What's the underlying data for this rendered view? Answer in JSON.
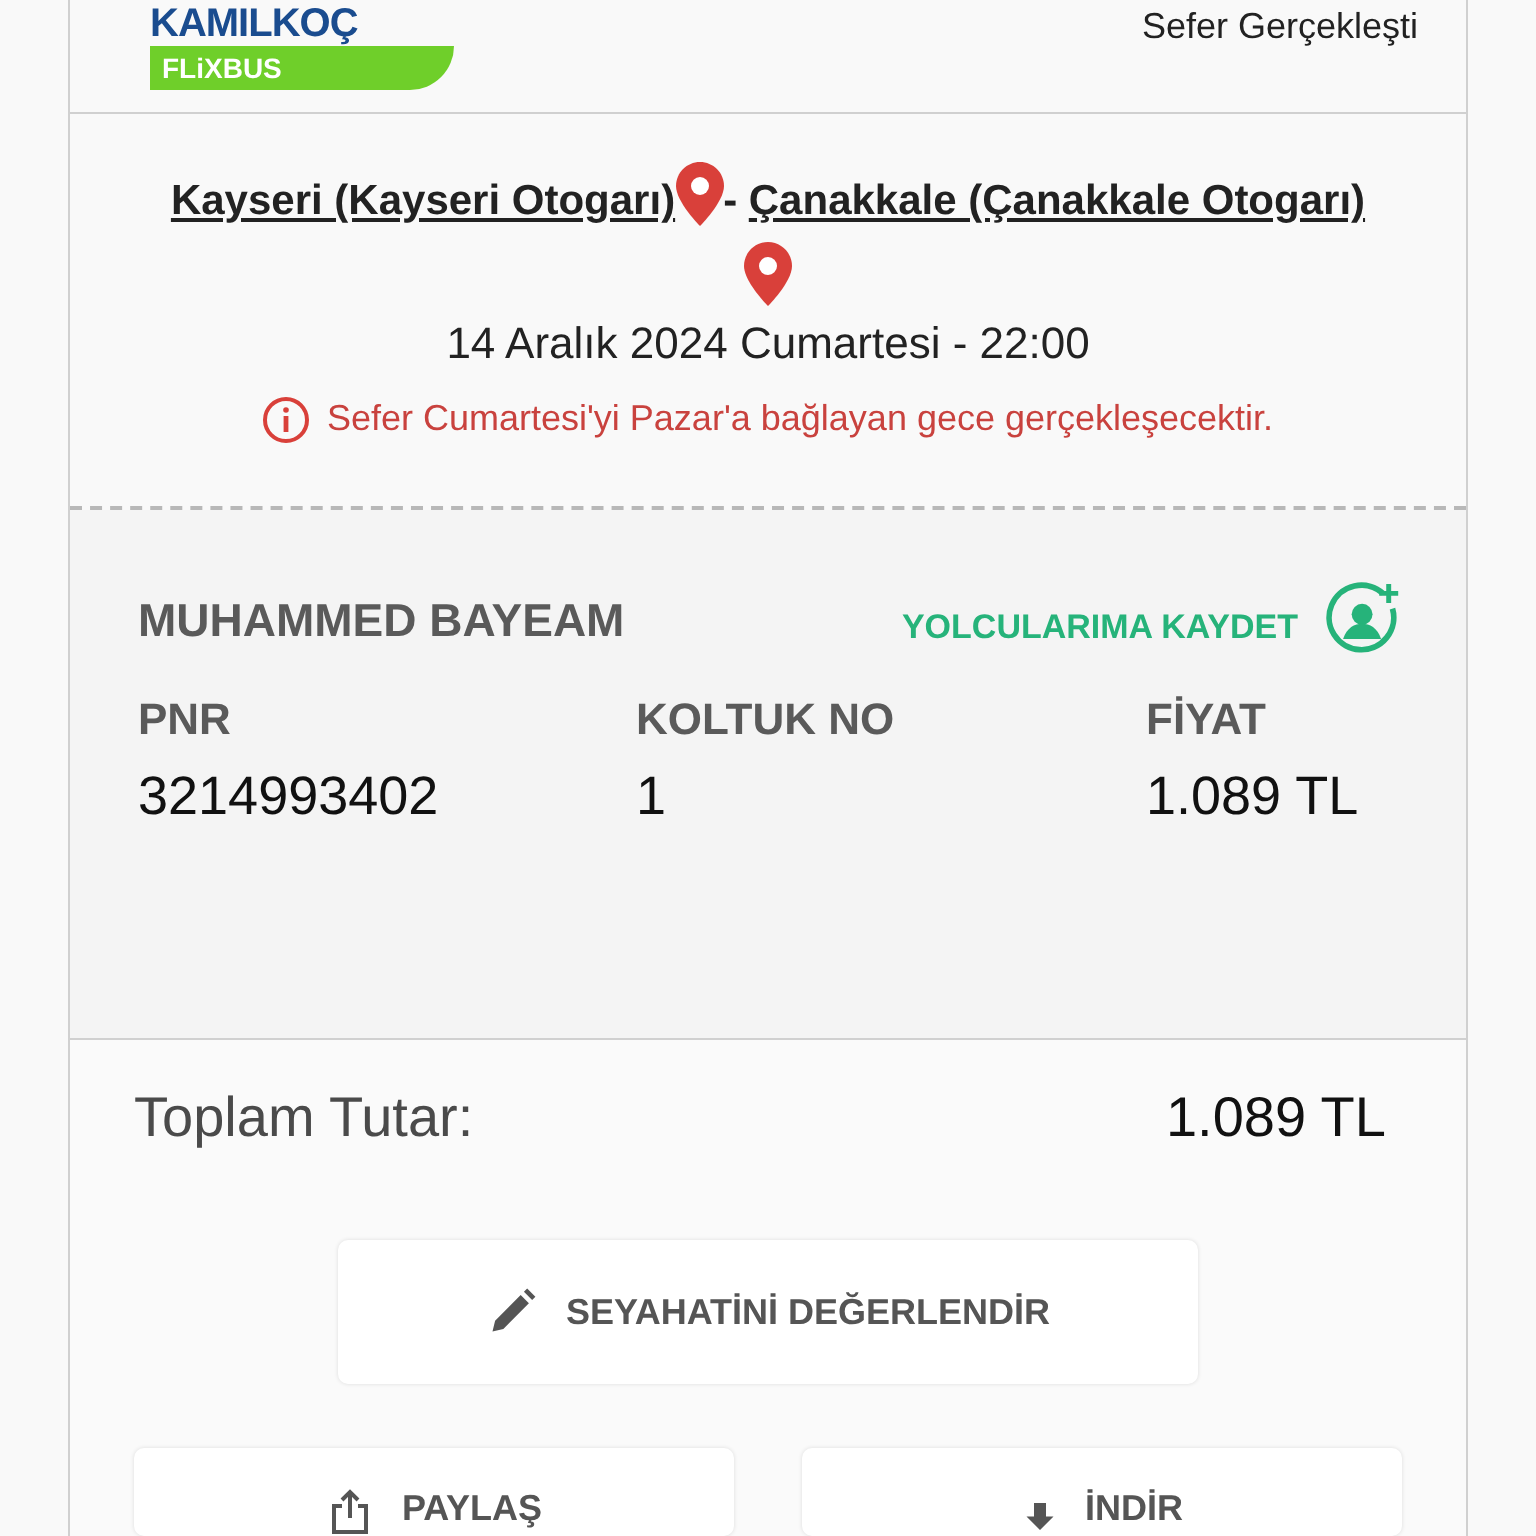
{
  "header": {
    "brand": "KAMILKOÇ",
    "sub_brand": "FLiXBUS",
    "status": "Sefer Gerçekleşti"
  },
  "route": {
    "origin": "Kayseri (Kayseri Otogarı)",
    "separator": "- ",
    "destination": "Çanakkale (Çanakkale Otogarı)",
    "datetime": "14 Aralık 2024 Cumartesi - 22:00",
    "notice": "Sefer Cumartesi'yi Pazar'a bağlayan gece gerçekleşecektir."
  },
  "passenger": {
    "name": "MUHAMMED BAYEAM",
    "save_action": "YOLCULARIMA KAYDET",
    "fields": [
      {
        "label": "PNR",
        "value": "3214993402"
      },
      {
        "label": "KOLTUK NO",
        "value": "1"
      },
      {
        "label": "FİYAT",
        "value": "1.089 TL"
      }
    ]
  },
  "total": {
    "label": "Toplam Tutar:",
    "value": "1.089 TL"
  },
  "actions": [
    {
      "kind": "rate",
      "label": "SEYAHATİNİ DEĞERLENDİR"
    },
    {
      "kind": "share",
      "label": "PAYLAŞ"
    },
    {
      "kind": "download",
      "label": "İNDİR"
    }
  ]
}
